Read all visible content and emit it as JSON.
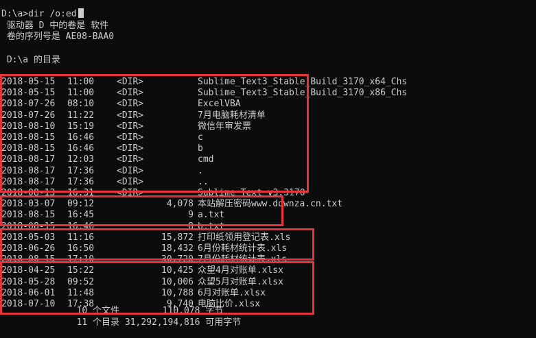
{
  "terminal": {
    "prompt": "D:\\a>dir /o:ed",
    "volume_line": " 驱动器 D 中的卷是 软件",
    "serial_line": " 卷的序列号是 AE08-BAA0",
    "dir_line": " D:\\a 的目录"
  },
  "entries": [
    {
      "date": "2018-05-15",
      "time": "11:00",
      "type": "<DIR>",
      "size": "",
      "name": "Sublime_Text3_Stable_Build_3170_x64_Chs"
    },
    {
      "date": "2018-05-15",
      "time": "11:00",
      "type": "<DIR>",
      "size": "",
      "name": "Sublime_Text3_Stable_Build_3170_x86_Chs"
    },
    {
      "date": "2018-07-26",
      "time": "08:10",
      "type": "<DIR>",
      "size": "",
      "name": "ExcelVBA"
    },
    {
      "date": "2018-07-26",
      "time": "11:22",
      "type": "<DIR>",
      "size": "",
      "name": "7月电脑耗材清单"
    },
    {
      "date": "2018-08-10",
      "time": "15:19",
      "type": "<DIR>",
      "size": "",
      "name": "微信年审发票"
    },
    {
      "date": "2018-08-15",
      "time": "16:46",
      "type": "<DIR>",
      "size": "",
      "name": "c"
    },
    {
      "date": "2018-08-15",
      "time": "16:46",
      "type": "<DIR>",
      "size": "",
      "name": "b"
    },
    {
      "date": "2018-08-17",
      "time": "12:03",
      "type": "<DIR>",
      "size": "",
      "name": "cmd"
    },
    {
      "date": "2018-08-17",
      "time": "17:36",
      "type": "<DIR>",
      "size": "",
      "name": "."
    },
    {
      "date": "2018-08-17",
      "time": "17:36",
      "type": "<DIR>",
      "size": "",
      "name": ".."
    },
    {
      "date": "2018-08-13",
      "time": "16:31",
      "type": "<DIR>",
      "size": "",
      "name": "Sublime Text v3.3170"
    },
    {
      "date": "2018-03-07",
      "time": "09:12",
      "type": "",
      "size": "4,078",
      "name": "本站解压密码www.downza.cn.txt"
    },
    {
      "date": "2018-08-15",
      "time": "16:45",
      "type": "",
      "size": "9",
      "name": "a.txt"
    },
    {
      "date": "2018-08-15",
      "time": "16:46",
      "type": "",
      "size": "8",
      "name": "b.txt"
    },
    {
      "date": "2018-05-03",
      "time": "11:16",
      "type": "",
      "size": "15,872",
      "name": "打印纸领用登记表.xls"
    },
    {
      "date": "2018-06-26",
      "time": "16:50",
      "type": "",
      "size": "18,432",
      "name": "6月份耗材统计表.xls"
    },
    {
      "date": "2018-08-15",
      "time": "17:10",
      "type": "",
      "size": "30,720",
      "name": "7月份耗材统计表.xls"
    },
    {
      "date": "2018-04-25",
      "time": "15:22",
      "type": "",
      "size": "10,425",
      "name": "众望4月对账单.xlsx"
    },
    {
      "date": "2018-05-28",
      "time": "09:52",
      "type": "",
      "size": "10,006",
      "name": "众望5月对账单.xlsx"
    },
    {
      "date": "2018-06-01",
      "time": "11:48",
      "type": "",
      "size": "10,788",
      "name": "6月对账单.xlsx"
    },
    {
      "date": "2018-07-10",
      "time": "17:38",
      "type": "",
      "size": "9,740",
      "name": "电脑比价.xlsx"
    }
  ],
  "summary": {
    "files_line": "              10 个文件        110,078 字节",
    "dirs_line": "              11 个目录 31,292,194,816 可用字节"
  },
  "highlight_color": "#e8333a"
}
